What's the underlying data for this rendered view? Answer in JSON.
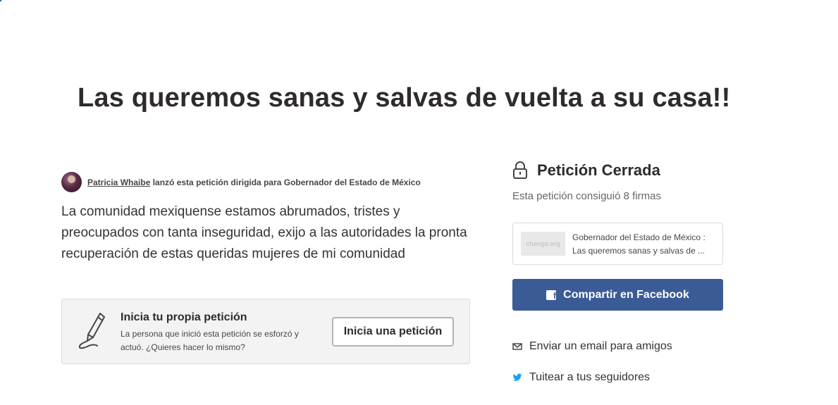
{
  "petition": {
    "title": "Las queremos sanas y salvas de vuelta a su casa!!",
    "author_name": "Patricia Whaibe",
    "author_suffix": " lanzó esta petición dirigida para Gobernador del Estado de México",
    "description": "La comunidad mexiquense estamos abrumados, tristes y preocupados con tanta inseguridad, exijo a las autoridades la pronta recuperación de estas queridas mujeres de mi comunidad"
  },
  "start_box": {
    "title": "Inicia tu propia petición",
    "description": "La persona que inició esta petición se esforzó y actuó. ¿Quieres hacer lo mismo?",
    "button_label": "Inicia una petición",
    "icon": "pen-signature-icon"
  },
  "sidebar": {
    "status_title": "Petición Cerrada",
    "status_subtitle": "Esta petición consiguió 8 firmas",
    "card": {
      "thumb_text": "change.org",
      "line1": "Gobernador del Estado de México :",
      "line2": "Las queremos sanas y salvas de ..."
    },
    "facebook_button": "Compartir en Facebook",
    "email_link": "Enviar un email para amigos",
    "twitter_link": "Tuitear a tus seguidores"
  },
  "colors": {
    "facebook": "#3b5b97",
    "twitter": "#1da1f2",
    "text": "#2f2b2b"
  }
}
